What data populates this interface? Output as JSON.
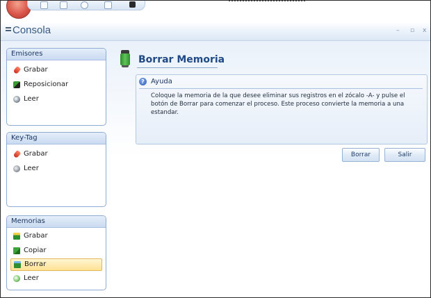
{
  "window": {
    "title": "Consola",
    "min_glyph": "–",
    "max_glyph": "▫",
    "close_glyph": "x"
  },
  "sidebar": {
    "groups": [
      {
        "header": "Emisores",
        "items": [
          {
            "label": "Grabar",
            "icon": "record-icon"
          },
          {
            "label": "Reposicionar",
            "icon": "reposition-icon"
          },
          {
            "label": "Leer",
            "icon": "read-icon"
          }
        ]
      },
      {
        "header": "Key-Tag",
        "items": [
          {
            "label": "Grabar",
            "icon": "record-icon"
          },
          {
            "label": "Leer",
            "icon": "read-icon"
          }
        ]
      },
      {
        "header": "Memorias",
        "items": [
          {
            "label": "Grabar",
            "icon": "record-icon"
          },
          {
            "label": "Copiar",
            "icon": "copy-icon"
          },
          {
            "label": "Borrar",
            "icon": "erase-icon",
            "selected": true
          },
          {
            "label": "Leer",
            "icon": "read-icon"
          }
        ]
      }
    ]
  },
  "main": {
    "heading": "Borrar Memoria",
    "help": {
      "icon_glyph": "?",
      "title": "Ayuda",
      "text": "Coloque la memoria de la que desee eliminar sus registros en el zócalo -A- y pulse el botón de Borrar para comenzar el proceso. Este proceso convierte la memoria a una estandar."
    },
    "buttons": {
      "borrar": "Borrar",
      "salir": "Salir"
    }
  },
  "colors": {
    "accent": "#1f4a85",
    "selected_bg": "#ffe193",
    "panel_border": "#90abd0"
  }
}
